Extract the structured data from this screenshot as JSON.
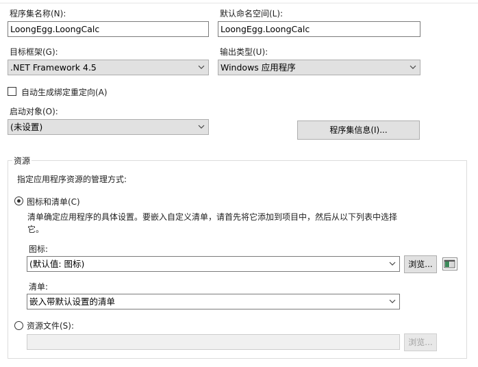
{
  "assembly": {
    "name_label": "程序集名称(N):",
    "name_value": "LoongEgg.LoongCalc",
    "namespace_label": "默认命名空间(L):",
    "namespace_value": "LoongEgg.LoongCalc",
    "target_framework_label": "目标框架(G):",
    "target_framework_value": ".NET Framework 4.5",
    "output_type_label": "输出类型(U):",
    "output_type_value": "Windows 应用程序",
    "auto_binding_label": "自动生成绑定重定向(A)",
    "startup_label": "启动对象(O):",
    "startup_value": "(未设置)",
    "assembly_info_button": "程序集信息(I)..."
  },
  "resources": {
    "group_title": "资源",
    "description": "指定应用程序资源的管理方式:",
    "icon_manifest_radio": "图标和清单(C)",
    "icon_manifest_desc_line1": "清单确定应用程序的具体设置。要嵌入自定义清单，请首先将它添加到项目中，然后从以下列表中选择",
    "icon_manifest_desc_line2": "它。",
    "icon_label": "图标:",
    "icon_value": "(默认值: 图标)",
    "browse_button": "浏览...",
    "manifest_label": "清单:",
    "manifest_value": "嵌入带默认设置的清单",
    "resource_file_radio": "资源文件(S):",
    "browse_disabled_button": "浏览..."
  }
}
